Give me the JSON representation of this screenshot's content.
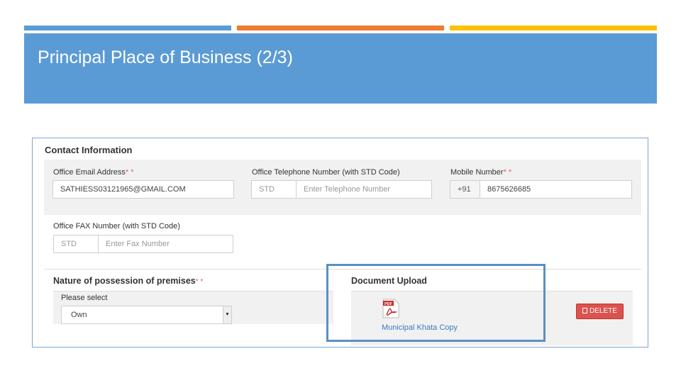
{
  "slide": {
    "title": "Principal Place of Business (2/3)",
    "colors": {
      "blue": "#5b9bd5",
      "orange": "#ed7d31",
      "yellow": "#ffc000"
    }
  },
  "form": {
    "contact_title": "Contact Information",
    "email": {
      "label": "Office Email Address",
      "required_mark": "* *",
      "value": "SATHIESS03121965@GMAIL.COM"
    },
    "telephone": {
      "label": "Office Telephone Number (with STD Code)",
      "std_placeholder": "STD",
      "number_placeholder": "Enter Telephone Number"
    },
    "mobile": {
      "label": "Mobile Number",
      "required_mark": "* *",
      "prefix": "+91",
      "value": "8675626685"
    },
    "fax": {
      "label": "Office FAX Number (with STD Code)",
      "std_placeholder": "STD",
      "number_placeholder": "Enter Fax Number"
    },
    "possession": {
      "title": "Nature of possession of premises",
      "required_mark": "* *",
      "select_label": "Please select",
      "selected": "Own"
    },
    "upload": {
      "title": "Document Upload",
      "pdf_badge": "PDF",
      "file_name": "Municipal Khata Copy",
      "delete_label": "DELETE"
    }
  }
}
